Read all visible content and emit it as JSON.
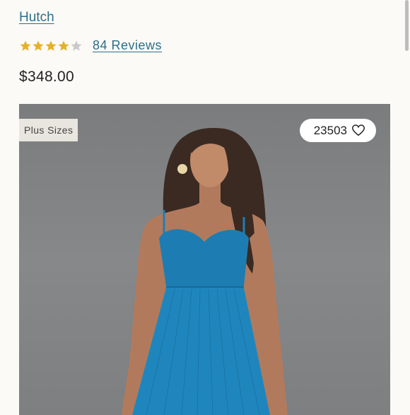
{
  "product": {
    "brand": "Hutch",
    "rating": 4,
    "rating_max": 5,
    "reviews_label": "84 Reviews",
    "price": "$348.00"
  },
  "image": {
    "badge": "Plus Sizes",
    "like_count": "23503",
    "like_icon": "heart-icon"
  },
  "colors": {
    "link": "#2e6f89",
    "star_filled": "#e5b12a",
    "star_empty": "#c9c9c9",
    "dress": "#1e7fb3",
    "background": "#fbfaf6"
  }
}
